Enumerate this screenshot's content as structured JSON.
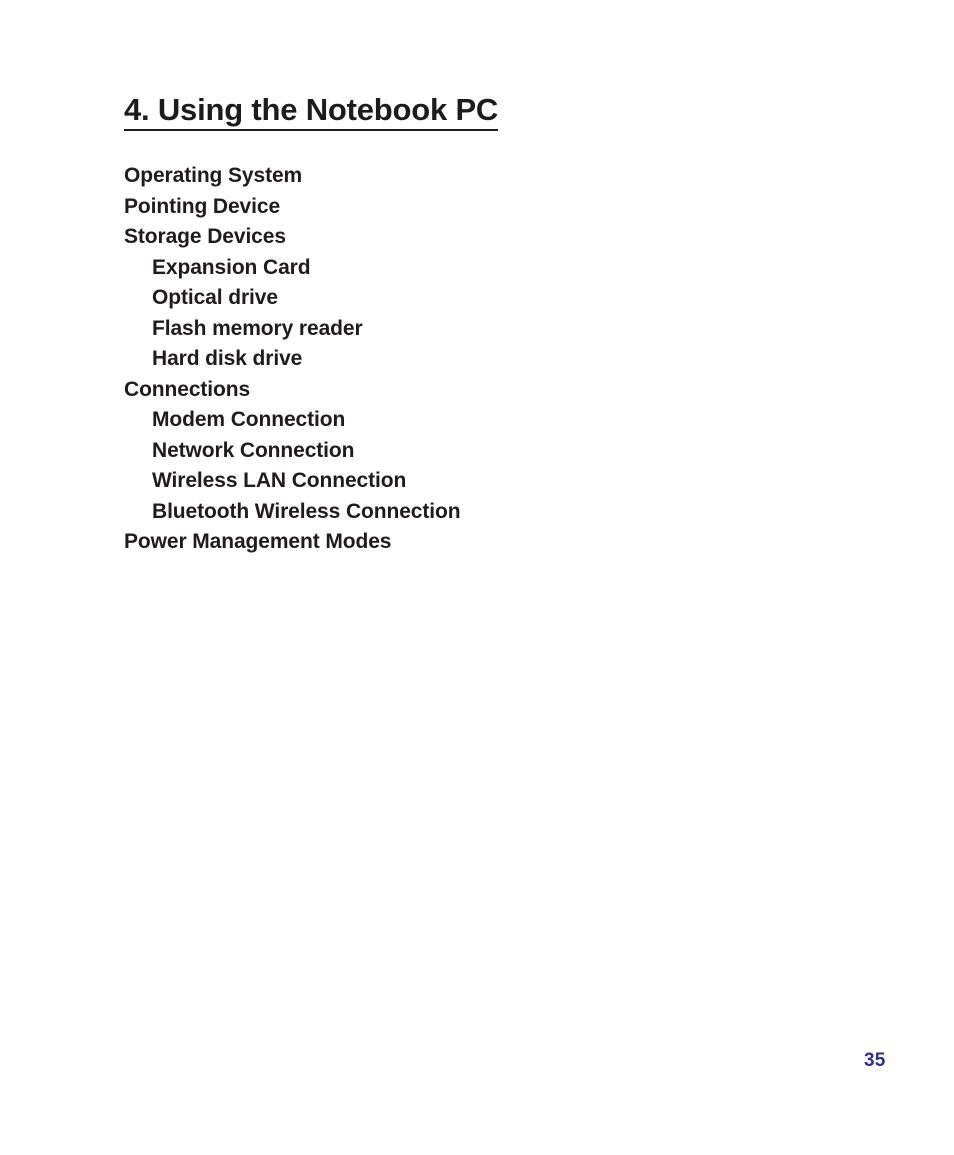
{
  "page": {
    "background_color": "#ffffff",
    "text_color": "#1f1c1d",
    "page_number": "35",
    "page_number_color": "#2e2e8f"
  },
  "chapter": {
    "title": "4. Using the Notebook PC"
  },
  "contents": [
    {
      "label": "Operating System",
      "level": 1
    },
    {
      "label": "Pointing Device",
      "level": 1
    },
    {
      "label": "Storage Devices",
      "level": 1
    },
    {
      "label": "Expansion Card",
      "level": 2
    },
    {
      "label": "Optical drive",
      "level": 2
    },
    {
      "label": "Flash memory reader",
      "level": 2
    },
    {
      "label": "Hard disk drive",
      "level": 2
    },
    {
      "label": "Connections",
      "level": 1
    },
    {
      "label": "Modem Connection",
      "level": 2
    },
    {
      "label": "Network Connection",
      "level": 2
    },
    {
      "label": "Wireless LAN Connection",
      "level": 2
    },
    {
      "label": "Bluetooth Wireless Connection",
      "level": 2
    },
    {
      "label": "Power Management Modes",
      "level": 1
    }
  ]
}
